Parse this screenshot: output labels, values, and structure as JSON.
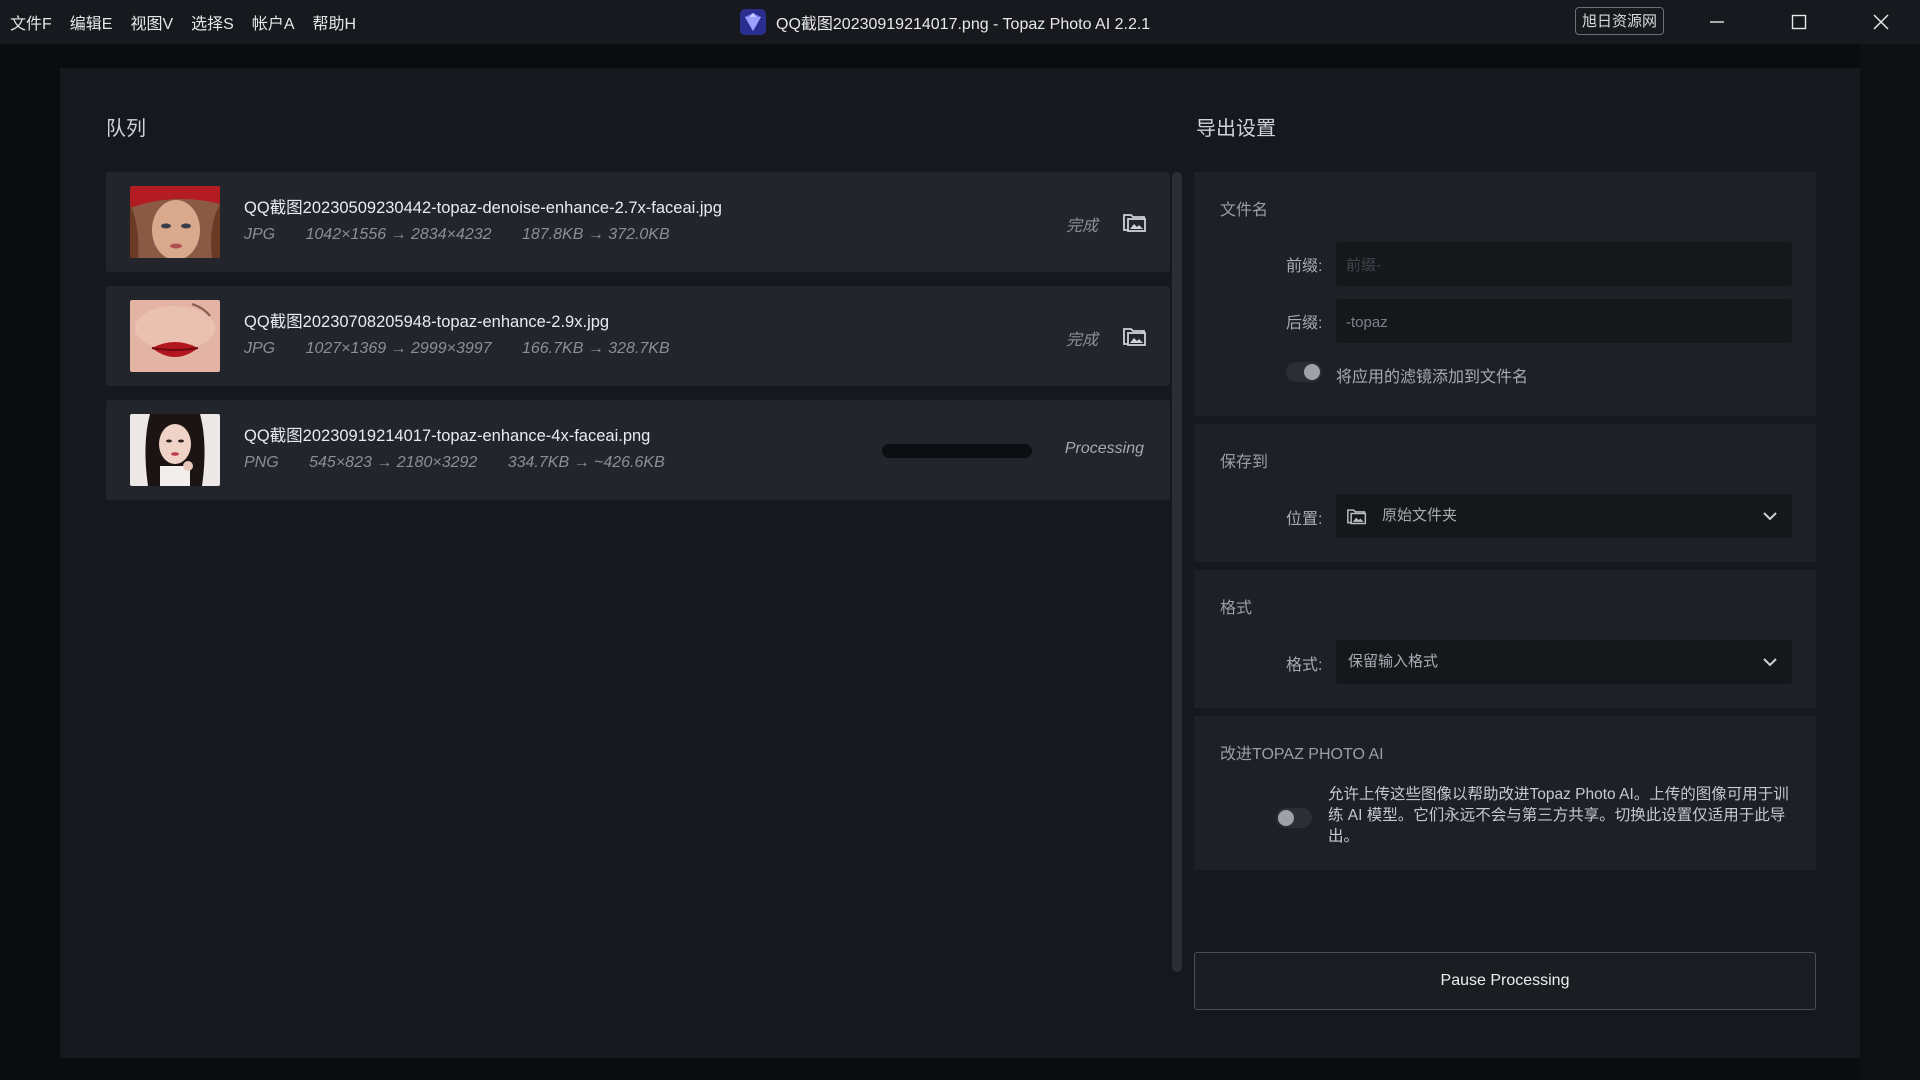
{
  "menu": [
    "文件F",
    "编辑E",
    "视图V",
    "选择S",
    "帐户A",
    "帮助H"
  ],
  "window": {
    "title": "QQ截图20230919214017.png - Topaz Photo AI 2.2.1",
    "watermark": "旭日资源网"
  },
  "queue": {
    "title": "队列",
    "items": [
      {
        "filename": "QQ截图20230509230442-topaz-denoise-enhance-2.7x-faceai.jpg",
        "format": "JPG",
        "dimensions": "1042×1556 → 2834×4232",
        "size": "187.8KB → 372.0KB",
        "status": "完成"
      },
      {
        "filename": "QQ截图20230708205948-topaz-enhance-2.9x.jpg",
        "format": "JPG",
        "dimensions": "1027×1369 → 2999×3997",
        "size": "166.7KB → 328.7KB",
        "status": "完成"
      },
      {
        "filename": "QQ截图20230919214017-topaz-enhance-4x-faceai.png",
        "format": "PNG",
        "dimensions": "545×823 → 2180×3292",
        "size": "334.7KB → ~426.6KB",
        "status": "Processing",
        "progress": 0
      }
    ]
  },
  "export": {
    "title": "导出设置",
    "filename": {
      "heading": "文件名",
      "prefix_label": "前缀:",
      "prefix_placeholder": "前缀-",
      "suffix_label": "后缀:",
      "suffix_value": "-topaz",
      "toggle_label": "将应用的滤镜添加到文件名",
      "toggle_on": false
    },
    "save_to": {
      "heading": "保存到",
      "location_label": "位置:",
      "location_value": "原始文件夹"
    },
    "format": {
      "heading": "格式",
      "format_label": "格式:",
      "format_value": "保留输入格式"
    },
    "improve": {
      "heading": "改进TOPAZ PHOTO AI",
      "description": "允许上传这些图像以帮助改进Topaz Photo AI。上传的图像可用于训练 AI 模型。它们永远不会与第三方共享。切换此设置仅适用于此导出。",
      "toggle_on": false
    },
    "pause_label": "Pause Processing"
  },
  "colors": {
    "background": "#0b0c0f",
    "dialog": "#16181d",
    "card": "#22252c",
    "panel": "#1d2026",
    "accent": "#5b5fe0"
  },
  "icons": [
    "topaz-app-icon",
    "minimize-icon",
    "maximize-icon",
    "close-icon",
    "folder-image-icon",
    "chevron-down-icon"
  ]
}
